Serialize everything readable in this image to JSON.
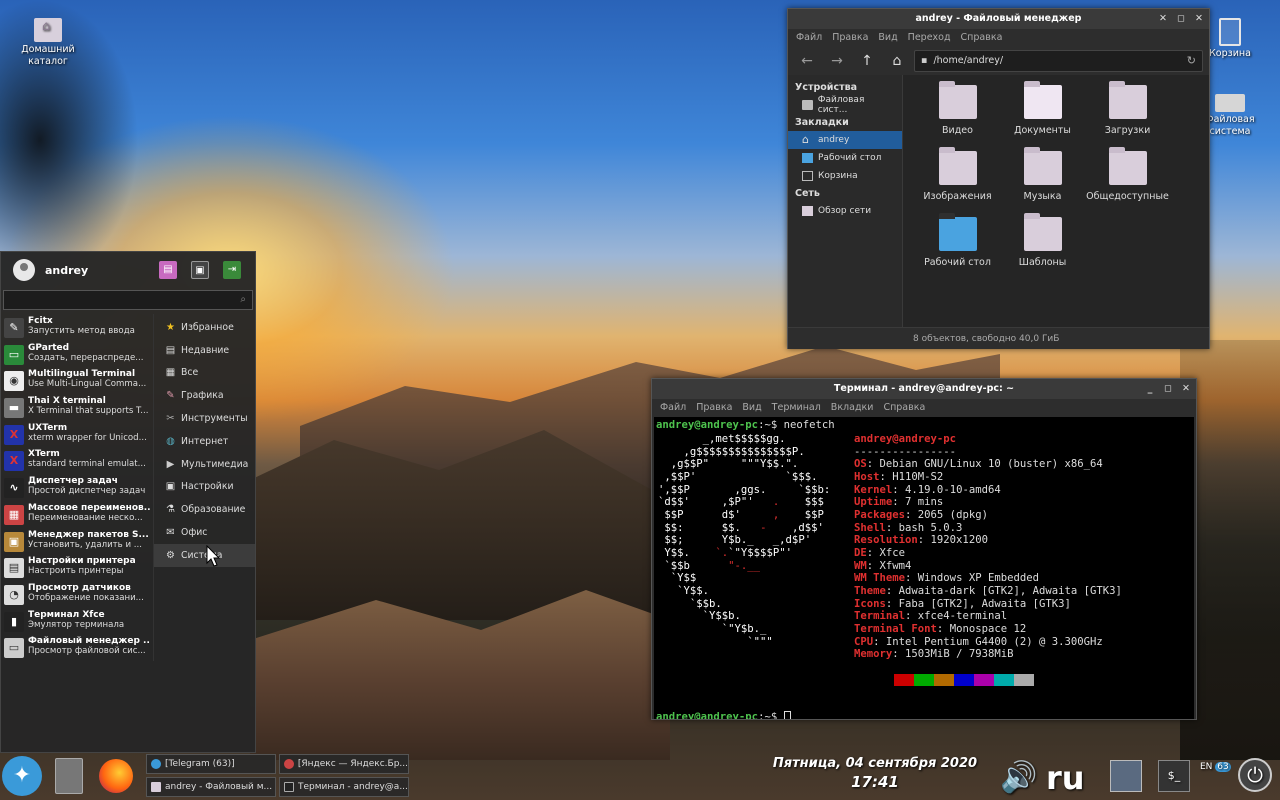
{
  "desktop": {
    "icons": [
      {
        "label": "Домашний каталог"
      },
      {
        "label": "Корзина"
      },
      {
        "label": "Файловая система"
      }
    ]
  },
  "file_manager": {
    "title": "andrey - Файловый менеджер",
    "menu": [
      "Файл",
      "Правка",
      "Вид",
      "Переход",
      "Справка"
    ],
    "path": "/home/andrey/",
    "sidebar": {
      "devices_header": "Устройства",
      "devices": [
        "Файловая сист..."
      ],
      "bookmarks_header": "Закладки",
      "bookmarks": [
        "andrey",
        "Рабочий стол",
        "Корзина"
      ],
      "network_header": "Сеть",
      "network": [
        "Обзор сети"
      ]
    },
    "folders": [
      "Видео",
      "Документы",
      "Загрузки",
      "Изображения",
      "Музыка",
      "Общедоступные",
      "Рабочий стол",
      "Шаблоны"
    ],
    "status": "8 объектов, свободно 40,0 ГиБ"
  },
  "terminal": {
    "title": "Терминал - andrey@andrey-pc: ~",
    "menu": [
      "Файл",
      "Правка",
      "Вид",
      "Терминал",
      "Вкладки",
      "Справка"
    ],
    "prompt": "andrey@andrey-pc",
    "prompt_suffix": ":~$ ",
    "command": "neofetch",
    "userhost": "andrey@andrey-pc",
    "separator": "----------------",
    "info": [
      {
        "key": "OS",
        "value": "Debian GNU/Linux 10 (buster) x86_64"
      },
      {
        "key": "Host",
        "value": "H110M-S2"
      },
      {
        "key": "Kernel",
        "value": "4.19.0-10-amd64"
      },
      {
        "key": "Uptime",
        "value": "7 mins"
      },
      {
        "key": "Packages",
        "value": "2065 (dpkg)"
      },
      {
        "key": "Shell",
        "value": "bash 5.0.3"
      },
      {
        "key": "Resolution",
        "value": "1920x1200"
      },
      {
        "key": "DE",
        "value": "Xfce"
      },
      {
        "key": "WM",
        "value": "Xfwm4"
      },
      {
        "key": "WM Theme",
        "value": "Windows XP Embedded"
      },
      {
        "key": "Theme",
        "value": "Adwaita-dark [GTK2], Adwaita [GTK3]"
      },
      {
        "key": "Icons",
        "value": "Faba [GTK2], Adwaita [GTK3]"
      },
      {
        "key": "Terminal",
        "value": "xfce4-terminal"
      },
      {
        "key": "Terminal Font",
        "value": "Monospace 12"
      },
      {
        "key": "CPU",
        "value": "Intel Pentium G4400 (2) @ 3.300GHz"
      },
      {
        "key": "Memory",
        "value": "1503MiB / 7938MiB"
      }
    ],
    "palette": [
      "#000000",
      "#cc0000",
      "#00aa00",
      "#b26a00",
      "#0000cc",
      "#aa00aa",
      "#00aaaa",
      "#aaaaaa"
    ]
  },
  "whisker_menu": {
    "username": "andrey",
    "search_placeholder": "",
    "apps": [
      {
        "name": "Fcitx",
        "desc": "Запустить метод ввода"
      },
      {
        "name": "GParted",
        "desc": "Создать, перераспреде..."
      },
      {
        "name": "Multilingual Terminal",
        "desc": "Use Multi-Lingual Comma..."
      },
      {
        "name": "Thai X terminal",
        "desc": "X Terminal that supports T..."
      },
      {
        "name": "UXTerm",
        "desc": "xterm wrapper for Unicod..."
      },
      {
        "name": "XTerm",
        "desc": "standard terminal emulat..."
      },
      {
        "name": "Диспетчер задач",
        "desc": "Простой диспетчер задач"
      },
      {
        "name": "Массовое переименов...",
        "desc": "Переименование неско..."
      },
      {
        "name": "Менеджер пакетов S...",
        "desc": "Установить, удалить и ..."
      },
      {
        "name": "Настройки принтера",
        "desc": "Настроить принтеры"
      },
      {
        "name": "Просмотр датчиков",
        "desc": "Отображение показани..."
      },
      {
        "name": "Терминал Xfce",
        "desc": "Эмулятор терминала"
      },
      {
        "name": "Файловый менеджер ...",
        "desc": "Просмотр файловой сис..."
      }
    ],
    "categories": [
      "Избранное",
      "Недавние",
      "Все",
      "Графика",
      "Инструменты",
      "Интернет",
      "Мультимедиа",
      "Настройки",
      "Образование",
      "Офис",
      "Система"
    ]
  },
  "taskbar": {
    "tasks": [
      {
        "label": "[Telegram (63)]"
      },
      {
        "label": "[Яндекс — Яндекс.Бр..."
      },
      {
        "label": "andrey - Файловый м..."
      },
      {
        "label": "Терминал - andrey@a..."
      }
    ],
    "date": "Пятница, 04 сентября 2020",
    "time": "17:41",
    "keyboard_layout": "ru",
    "tray_layout": "EN",
    "tray_badge": "63"
  }
}
